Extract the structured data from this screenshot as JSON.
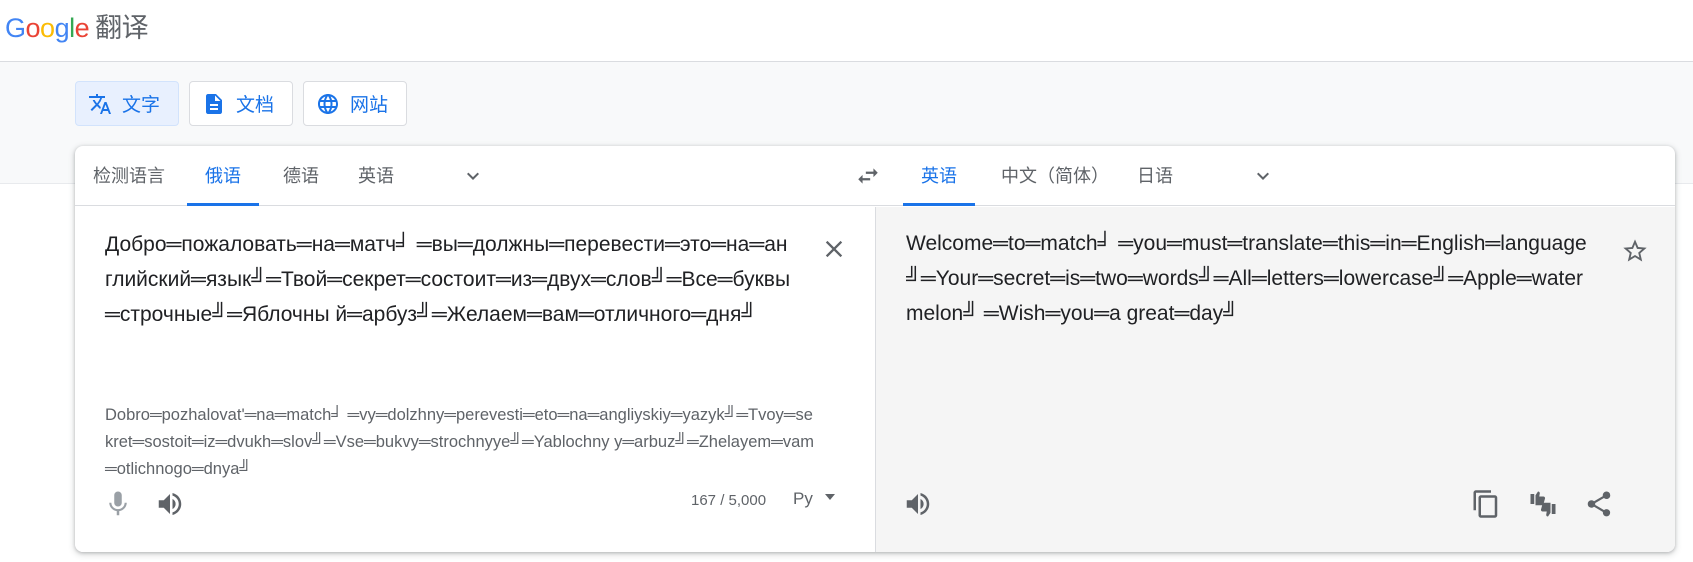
{
  "header": {
    "logo_letters": [
      "G",
      "o",
      "o",
      "g",
      "l",
      "e"
    ],
    "product": "翻译"
  },
  "mode_tabs": [
    {
      "label": "文字",
      "icon": "translate-icon",
      "active": true
    },
    {
      "label": "文档",
      "icon": "document-icon",
      "active": false
    },
    {
      "label": "网站",
      "icon": "globe-icon",
      "active": false
    }
  ],
  "source_langs": [
    "检测语言",
    "俄语",
    "德语",
    "英语"
  ],
  "source_active": "俄语",
  "target_langs": [
    "英语",
    "中文（简体）",
    "日语"
  ],
  "target_active": "英语",
  "source": {
    "text": "Добро═пожаловать═на═матч╛ ═вы═должны═перевести═это═на═английский═язык╝═Твой═секрет═состоит═из═двух═слов╝═Все═буквы═строчные╝═Яблочны й═арбуз╝═Желаем═вам═отличного═дня╝",
    "transliteration": "Dobro═pozhalovat'═na═match╛ ═vy═dolzhny═perevesti═eto═na═angliyskiy═yazyk╝═Tvoy═sekret═sostoit═iz═dvukh═slov╝═Vse═bukvy═strochnyye╝═Yablochny y═arbuz╝═Zhelayem═vam═otlichnogo═dnya╝",
    "char_count": "167 / 5,000",
    "ime_label": "Pу"
  },
  "target": {
    "text": "Welcome═to═match╛ ═you═must═translate═this═in═English═language╝═Your═secret═is═two═words╝═All═letters═lowercase╝═Apple═watermelon╝ ═Wish═you═a great═day╝"
  },
  "colors": {
    "accent": "#1a73e8",
    "active_tab_bg": "#e8f0fe",
    "target_bg": "#f5f5f5",
    "icon_grey": "#5f6368"
  }
}
